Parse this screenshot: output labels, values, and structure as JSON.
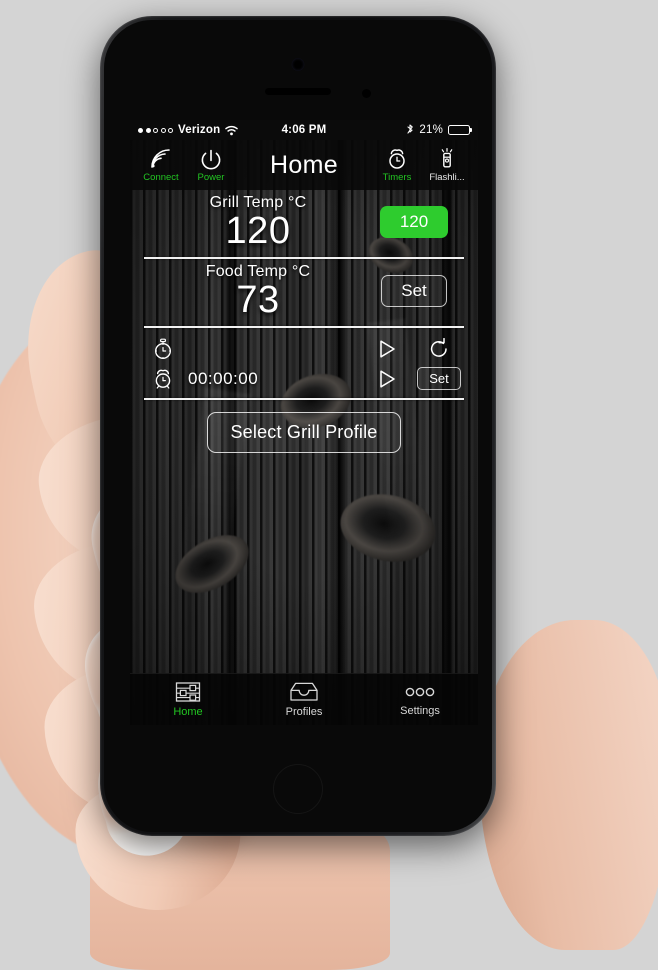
{
  "status_bar": {
    "carrier": "Verizon",
    "signal_dots_filled": 2,
    "signal_dots_total": 5,
    "wifi_icon": "wifi-icon",
    "time": "4:06 PM",
    "bluetooth_icon": "bluetooth-icon",
    "battery_percent": "21%",
    "battery_level": 21
  },
  "nav_bar": {
    "title": "Home",
    "left_buttons": [
      {
        "label": "Connect",
        "icon": "signal-arcs-icon",
        "color": "#22c522"
      },
      {
        "label": "Power",
        "icon": "power-icon",
        "color": "#22c522"
      }
    ],
    "right_buttons": [
      {
        "label": "Timers",
        "icon": "alarm-clock-icon",
        "color": "#22c522"
      },
      {
        "label": "Flashli...",
        "icon": "flashlight-icon",
        "color": "#e8e8e8"
      }
    ]
  },
  "grill": {
    "label": "Grill Temp °C",
    "value": "120",
    "setpoint_label": "120",
    "setpoint_color": "#2ecc2e"
  },
  "food": {
    "label": "Food Temp °C",
    "value": "73",
    "set_label": "Set"
  },
  "timers": {
    "stopwatch": {
      "icon": "stopwatch-icon",
      "play_icon": "play-icon",
      "reset_icon": "reset-icon"
    },
    "alarm": {
      "icon": "alarm-clock-icon",
      "time": "00:00:00",
      "play_icon": "play-icon",
      "set_label": "Set"
    }
  },
  "profile": {
    "button_label": "Select Grill Profile"
  },
  "tab_bar": {
    "tabs": [
      {
        "label": "Home",
        "icon": "sliders-icon",
        "active": true
      },
      {
        "label": "Profiles",
        "icon": "tray-icon",
        "active": false
      },
      {
        "label": "Settings",
        "icon": "three-dots-icon",
        "active": false
      }
    ]
  },
  "theme": {
    "accent_green": "#22c522",
    "pill_green": "#2ecc2e",
    "text_white": "#ffffff",
    "screen_bg": "#2c2c2c"
  }
}
